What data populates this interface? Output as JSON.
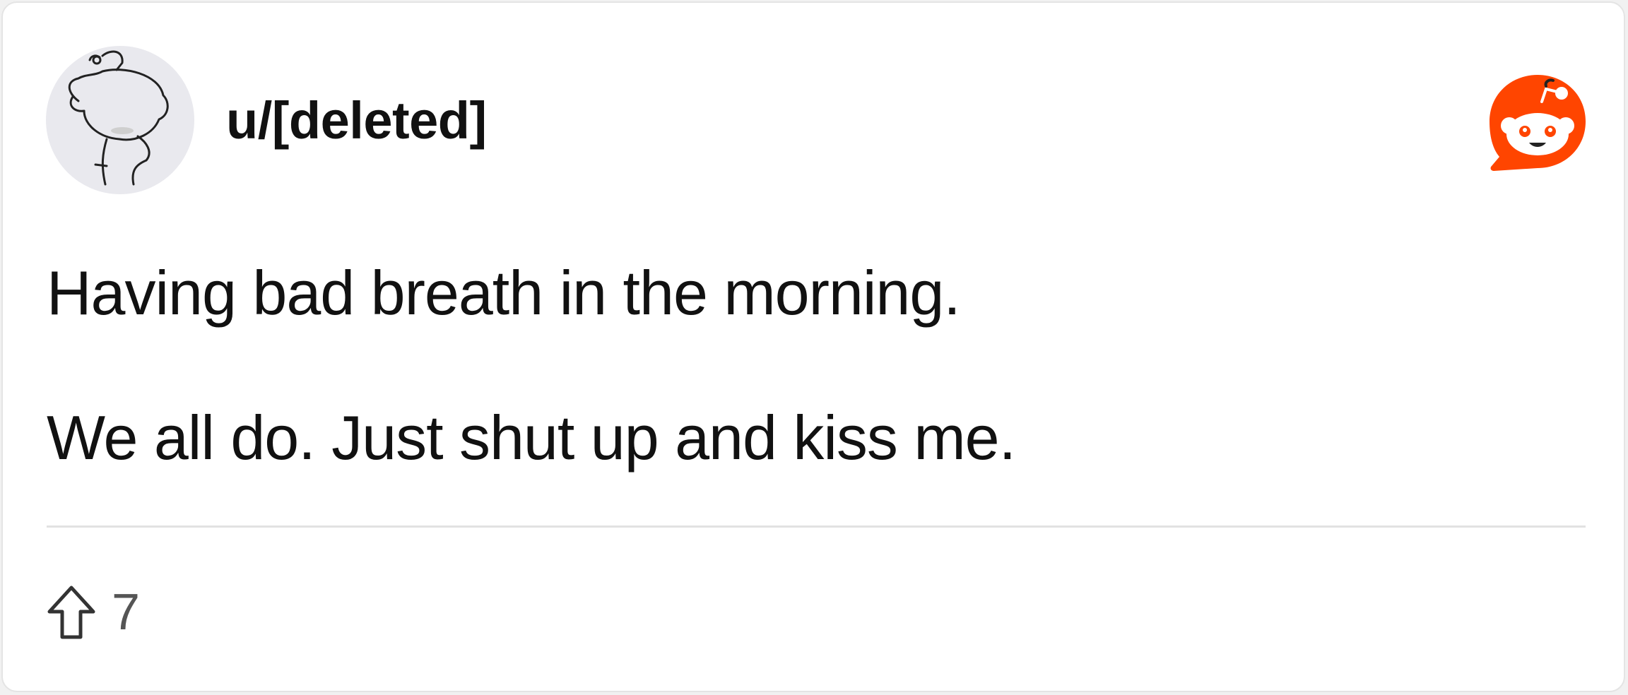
{
  "post": {
    "username": "u/[deleted]",
    "body_lines": [
      "Having bad breath in the morning.",
      "We all do. Just shut up and kiss me."
    ],
    "upvotes": "7"
  },
  "icons": {
    "avatar": "snoo-avatar-icon",
    "brand": "reddit-logo-icon",
    "upvote": "upvote-arrow-icon"
  },
  "colors": {
    "brand": "#ff4500",
    "text": "#111111",
    "muted": "#555555",
    "divider": "#e2e2e2"
  }
}
